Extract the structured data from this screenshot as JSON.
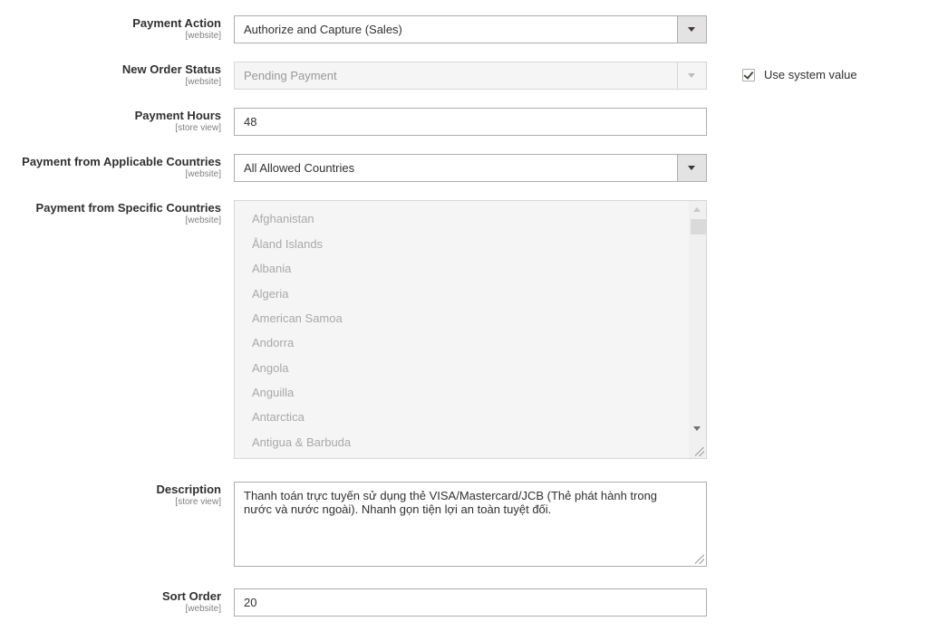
{
  "fields": {
    "payment_action": {
      "label": "Payment Action",
      "scope": "[website]",
      "value": "Authorize and Capture (Sales)"
    },
    "new_order_status": {
      "label": "New Order Status",
      "scope": "[website]",
      "value": "Pending Payment",
      "use_system_value_label": "Use system value",
      "use_system_value_checked": true
    },
    "payment_hours": {
      "label": "Payment Hours",
      "scope": "[store view]",
      "value": "48"
    },
    "applicable_countries": {
      "label": "Payment from Applicable Countries",
      "scope": "[website]",
      "value": "All Allowed Countries"
    },
    "specific_countries": {
      "label": "Payment from Specific Countries",
      "scope": "[website]",
      "options": [
        "Afghanistan",
        "Åland Islands",
        "Albania",
        "Algeria",
        "American Samoa",
        "Andorra",
        "Angola",
        "Anguilla",
        "Antarctica",
        "Antigua & Barbuda"
      ]
    },
    "description": {
      "label": "Description",
      "scope": "[store view]",
      "value": "Thanh toán trực tuyến sử dụng thẻ VISA/Mastercard/JCB (Thẻ phát hành trong nước và nước ngoài). Nhanh gọn tiện lợi an toàn tuyệt đối."
    },
    "sort_order": {
      "label": "Sort Order",
      "scope": "[website]",
      "value": "20"
    }
  }
}
